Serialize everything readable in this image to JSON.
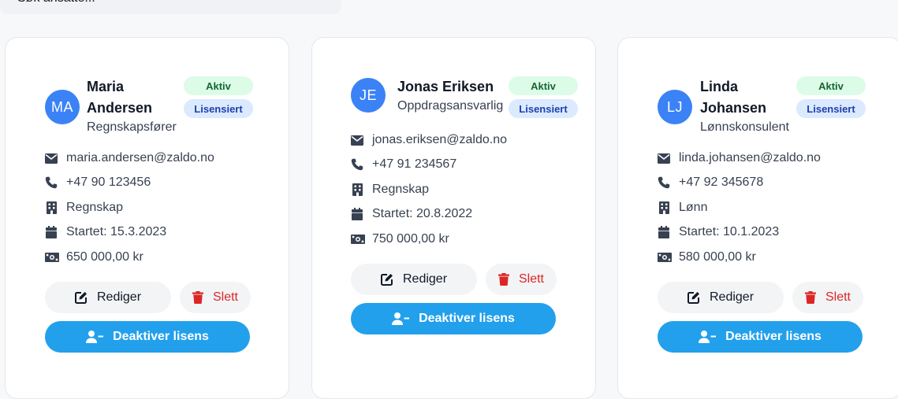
{
  "search": {
    "placeholder": "Søk ansatte..."
  },
  "labels": {
    "edit": "Rediger",
    "delete": "Slett",
    "deactivate": "Deaktiver lisens"
  },
  "colors": {
    "accent": "#22a0ec",
    "avatar": "#3b82f6",
    "danger": "#dc2626",
    "active_bg": "#dcfce7",
    "license_bg": "#dbeafe"
  },
  "employees": [
    {
      "initials": "MA",
      "name_line1": "Maria",
      "name_line2": "Andersen",
      "role": "Regnskapsfører",
      "status": "Aktiv",
      "license": "Lisensiert",
      "email": "maria.andersen@zaldo.no",
      "phone": "+47 90 123456",
      "department": "Regnskap",
      "started": "Startet: 15.3.2023",
      "salary": "650 000,00 kr"
    },
    {
      "initials": "JE",
      "name_line1": "Jonas Eriksen",
      "name_line2": "",
      "role": "Oppdragsansvarlig",
      "status": "Aktiv",
      "license": "Lisensiert",
      "email": "jonas.eriksen@zaldo.no",
      "phone": "+47 91 234567",
      "department": "Regnskap",
      "started": "Startet: 20.8.2022",
      "salary": "750 000,00 kr"
    },
    {
      "initials": "LJ",
      "name_line1": "Linda",
      "name_line2": "Johansen",
      "role": "Lønnskonsulent",
      "status": "Aktiv",
      "license": "Lisensiert",
      "email": "linda.johansen@zaldo.no",
      "phone": "+47 92 345678",
      "department": "Lønn",
      "started": "Startet: 10.1.2023",
      "salary": "580 000,00 kr"
    }
  ]
}
